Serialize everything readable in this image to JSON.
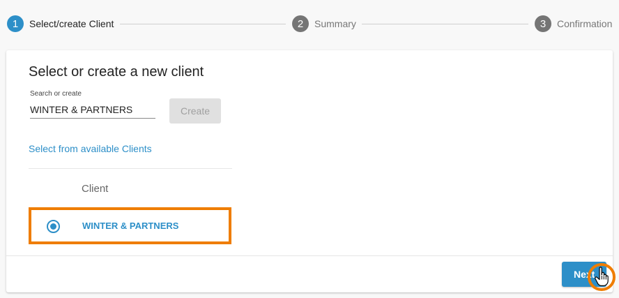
{
  "stepper": {
    "steps": [
      {
        "number": "1",
        "label": "Select/create Client",
        "state": "active"
      },
      {
        "number": "2",
        "label": "Summary",
        "state": "inactive"
      },
      {
        "number": "3",
        "label": "Confirmation",
        "state": "inactive"
      }
    ]
  },
  "card": {
    "title": "Select or create a new client",
    "search": {
      "label": "Search or create",
      "value": "WINTER & PARTNERS"
    },
    "create_label": "Create",
    "available_link": "Select from available Clients",
    "table": {
      "column_header": "Client",
      "rows": [
        {
          "name": "WINTER & PARTNERS",
          "selected": true
        }
      ]
    },
    "next_label": "Next"
  },
  "icons": {
    "cursor": "hand-pointer-icon",
    "radio": "radio-selected-icon"
  },
  "colors": {
    "accent": "#2d8fc8",
    "highlight": "#ef7d00",
    "inactive_step": "#757575"
  }
}
